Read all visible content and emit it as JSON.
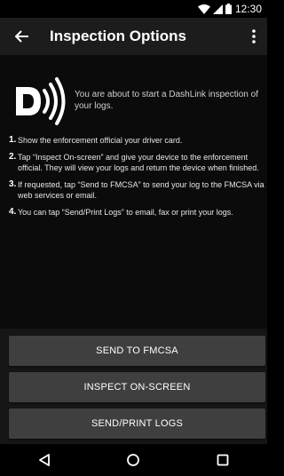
{
  "status_bar": {
    "time": "12:30",
    "icons": [
      "wifi-icon",
      "signal-icon",
      "battery-icon"
    ]
  },
  "app_bar": {
    "back_icon": "arrow-left-icon",
    "title": "Inspection Options",
    "overflow_icon": "more-vertical-icon"
  },
  "intro": {
    "logo_icon": "dashlink-logo",
    "text": "You are about to start a DashLink inspection of your logs."
  },
  "steps": [
    {
      "number": "1.",
      "text": "Show the enforcement official your driver card."
    },
    {
      "number": "2.",
      "text": "Tap “Inspect On-screen” and give your device to the enforcement official. They will view your logs and return the device when finished."
    },
    {
      "number": "3.",
      "text": "If requested, tap “Send to FMCSA” to send your log to the FMCSA via web services or email."
    },
    {
      "number": "4.",
      "text": "You can tap “Send/Print Logs” to email, fax or print your logs."
    }
  ],
  "buttons": {
    "send_fmcsa": "SEND TO FMCSA",
    "inspect_onscreen": "INSPECT ON-SCREEN",
    "send_print_logs": "SEND/PRINT LOGS"
  },
  "nav_bar": {
    "icons": [
      "back-triangle-icon",
      "home-circle-icon",
      "recents-square-icon"
    ]
  },
  "colors": {
    "app_bar_bg": "#1c1c1c",
    "content_bg": "#0b0b0b",
    "button_bg": "#3f3f3f",
    "text": "#ffffff"
  }
}
